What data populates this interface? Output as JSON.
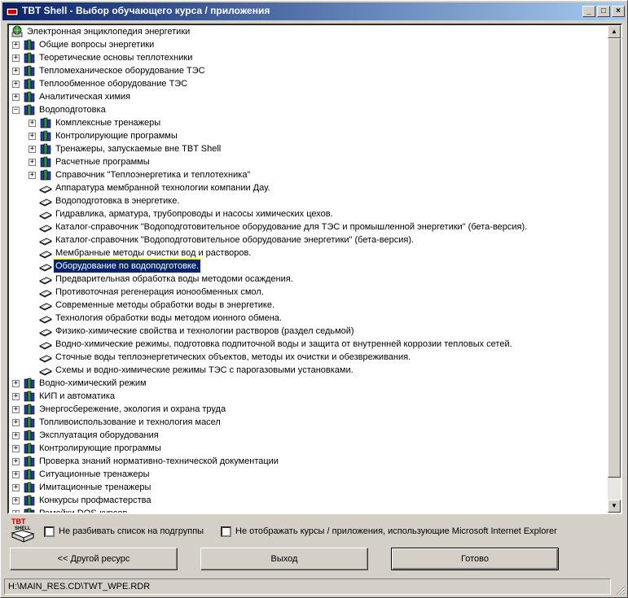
{
  "window": {
    "title": "TBT Shell - Выбор обучающего курса / приложения",
    "title_icon": "tbt-logo-icon"
  },
  "title_buttons": {
    "minimize": "_",
    "maximize": "□",
    "close": "×"
  },
  "tree": {
    "root_label": "Электронная энциклопедия энергетики",
    "items": [
      {
        "label": "Общие вопросы энергетики",
        "level": 1,
        "type": "folder",
        "expander": "+"
      },
      {
        "label": "Теоретические основы теплотехники",
        "level": 1,
        "type": "folder",
        "expander": "+"
      },
      {
        "label": "Тепломеханическое оборудование ТЭС",
        "level": 1,
        "type": "folder",
        "expander": "+"
      },
      {
        "label": "Теплообменное оборудование ТЭС",
        "level": 1,
        "type": "folder",
        "expander": "+"
      },
      {
        "label": "Аналитическая химия",
        "level": 1,
        "type": "folder",
        "expander": "+"
      },
      {
        "label": "Водоподготовка",
        "level": 1,
        "type": "folder",
        "expander": "-"
      },
      {
        "label": "Комплексные тренажеры",
        "level": 2,
        "type": "folder",
        "expander": "+"
      },
      {
        "label": "Контролирующие программы",
        "level": 2,
        "type": "folder",
        "expander": "+"
      },
      {
        "label": "Тренажеры, запускаемые вне TBT Shell",
        "level": 2,
        "type": "folder",
        "expander": "+"
      },
      {
        "label": "Расчетные программы",
        "level": 2,
        "type": "folder",
        "expander": "+"
      },
      {
        "label": "Справочник \"Теплоэнергетика и теплотехника\"",
        "level": 2,
        "type": "folder",
        "expander": "+"
      },
      {
        "label": "Аппаратура мембранной технологии компании Дау.",
        "level": 2,
        "type": "doc"
      },
      {
        "label": "Водоподготовка в энергетике.",
        "level": 2,
        "type": "doc"
      },
      {
        "label": "Гидравлика, арматура, трубопроводы и насосы химических цехов.",
        "level": 2,
        "type": "doc"
      },
      {
        "label": "Каталог-справочник \"Водоподготовительное оборудование для ТЭС и промышленной энергетики\" (бета-версия).",
        "level": 2,
        "type": "doc"
      },
      {
        "label": "Каталог-справочник \"Водоподготовительное оборудование энергетики\" (бета-версия).",
        "level": 2,
        "type": "doc"
      },
      {
        "label": "Мембранные методы очистки вод и растворов.",
        "level": 2,
        "type": "doc"
      },
      {
        "label": "Оборудование по водоподготовке.",
        "level": 2,
        "type": "doc",
        "selected": true
      },
      {
        "label": "Предварительная обработка воды методоми осаждения.",
        "level": 2,
        "type": "doc"
      },
      {
        "label": "Противоточная регенерация ионообменных смол.",
        "level": 2,
        "type": "doc"
      },
      {
        "label": "Современные методы обработки воды в энергетике.",
        "level": 2,
        "type": "doc"
      },
      {
        "label": "Технология обработки воды методом ионного обмена.",
        "level": 2,
        "type": "doc"
      },
      {
        "label": "Физико-химические свойства и технологии растворов (раздел седьмой)",
        "level": 2,
        "type": "doc"
      },
      {
        "label": "Водно-химические режимы, подготовка подпиточной воды и защита от внутренней коррозии тепловых сетей.",
        "level": 2,
        "type": "doc"
      },
      {
        "label": "Сточные воды теплоэнергетических объектов, методы их очистки и обезвреживания.",
        "level": 2,
        "type": "doc"
      },
      {
        "label": "Схемы и водно-химические режимы ТЭС с парогазовыми установками.",
        "level": 2,
        "type": "doc"
      },
      {
        "label": "Водно-химический режим",
        "level": 1,
        "type": "folder",
        "expander": "+"
      },
      {
        "label": "КИП и автоматика",
        "level": 1,
        "type": "folder",
        "expander": "+"
      },
      {
        "label": "Энергосбережение, экология и охрана труда",
        "level": 1,
        "type": "folder",
        "expander": "+"
      },
      {
        "label": "Топливоиспользование и технология масел",
        "level": 1,
        "type": "folder",
        "expander": "+"
      },
      {
        "label": "Эксплуатация оборудования",
        "level": 1,
        "type": "folder",
        "expander": "+"
      },
      {
        "label": "Контролирующие программы",
        "level": 1,
        "type": "folder",
        "expander": "+"
      },
      {
        "label": "Проверка знаний нормативно-технической документации",
        "level": 1,
        "type": "folder",
        "expander": "+"
      },
      {
        "label": "Ситуационные тренажеры",
        "level": 1,
        "type": "folder",
        "expander": "+"
      },
      {
        "label": "Имитационные тренажеры",
        "level": 1,
        "type": "folder",
        "expander": "+"
      },
      {
        "label": "Конкурсы профмастерства",
        "level": 1,
        "type": "folder",
        "expander": "+"
      },
      {
        "label": "Ремейки DOS-курсов",
        "level": 1,
        "type": "folder",
        "expander": "+"
      }
    ]
  },
  "options": {
    "no_split": "Не разбивать список на подгруппы",
    "hide_ie": "Не отображать курсы / приложения, использующие Microsoft Internet Explorer"
  },
  "buttons": {
    "other_resource": "<< Другой ресурс",
    "exit": "Выход",
    "done": "Готово"
  },
  "status": {
    "path": "H:\\MAIN_RES.CD\\TWT_WPE.RDR"
  },
  "logo": {
    "line1": "TBT",
    "line2": "SHELL"
  }
}
